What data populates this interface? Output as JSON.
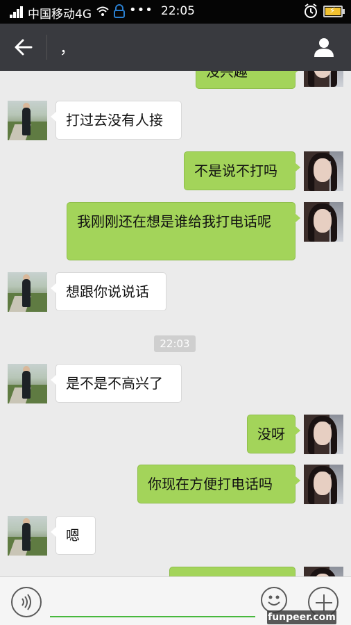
{
  "status_bar": {
    "carrier": "中国移动4G",
    "dots": "•••",
    "time": "22:05"
  },
  "header": {
    "title": "，",
    "back_icon": "arrow-left-icon",
    "profile_icon": "person-icon"
  },
  "messages": [
    {
      "side": "right",
      "text": "没兴趣",
      "partial": true
    },
    {
      "side": "left",
      "text": "打过去没有人接"
    },
    {
      "side": "right",
      "text": "不是说不打吗"
    },
    {
      "side": "right",
      "text": "我刚刚还在想是谁给我打电话呢"
    },
    {
      "side": "left",
      "text": "想跟你说说话"
    },
    {
      "side": "timestamp",
      "text": "22:03"
    },
    {
      "side": "left",
      "text": "是不是不高兴了"
    },
    {
      "side": "right",
      "text": "没呀"
    },
    {
      "side": "right",
      "text": "你现在方便打电话吗"
    },
    {
      "side": "left",
      "text": "嗯"
    },
    {
      "side": "right",
      "text": "",
      "partial": true
    }
  ],
  "input_bar": {
    "placeholder": "",
    "voice_icon": "voice-icon",
    "emoji_icon": "emoji-icon",
    "plus_icon": "plus-icon"
  },
  "watermark": "funpeer.com",
  "colors": {
    "status_bar": "#050505",
    "title_bar": "#393a3f",
    "chat_bg": "#ebebeb",
    "bubble_right": "#a3d45a",
    "bubble_left": "#ffffff",
    "input_underline": "#47b83d"
  }
}
